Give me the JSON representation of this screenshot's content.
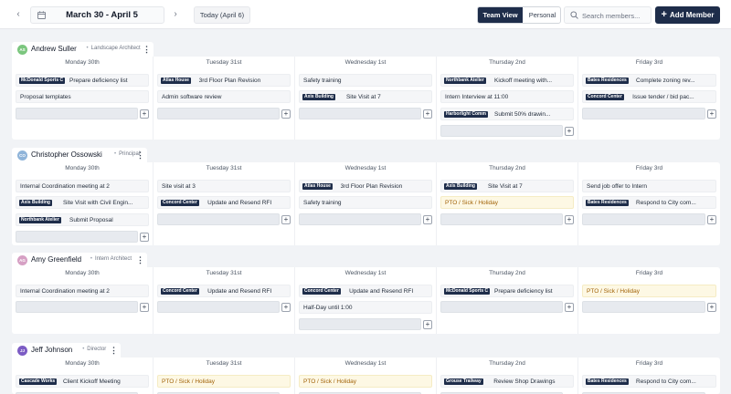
{
  "toolbar": {
    "prev_icon": "chevron-left-icon",
    "next_icon": "chevron-right-icon",
    "calendar_icon": "calendar-icon",
    "date_range": "March 30 - April 5",
    "today_label": "Today (April 6)",
    "view_team": "Team View",
    "view_personal": "Personal",
    "active_view": "Team View",
    "search_placeholder": "Search members...",
    "search_icon": "search-icon",
    "add_member_label": "Add Member",
    "accent_color": "#1e2d4a"
  },
  "days": [
    "Monday 30th",
    "Tuesday 31st",
    "Wednesday 1st",
    "Thursday 2nd",
    "Friday 3rd"
  ],
  "members": [
    {
      "initials": "AS",
      "name": "Andrew Suller",
      "role": "Landscape Architect",
      "avatar_color": "#7bc67e",
      "days": [
        [
          {
            "tag": "McDonald Sports C",
            "text": "Prepare deficiency list"
          },
          {
            "text": "Proposal templates"
          }
        ],
        [
          {
            "tag": "Atlas House",
            "text": "3rd Floor Plan Revision"
          },
          {
            "text": "Admin software review"
          }
        ],
        [
          {
            "text": "Safety training"
          },
          {
            "tag": "Axis Building",
            "text": "Site Visit at 7"
          }
        ],
        [
          {
            "tag": "Northbank Atelier",
            "text": "Kickoff meeting with..."
          },
          {
            "text": "Intern Interview at 11:00"
          },
          {
            "tag": "Harborlight Comm",
            "text": "Submit 50% drawin..."
          }
        ],
        [
          {
            "tag": "Bates Residences",
            "text": "Complete zoning rev..."
          },
          {
            "tag": "Concord Center",
            "text": "Issue tender / bid pac..."
          }
        ]
      ]
    },
    {
      "initials": "CO",
      "name": "Christopher Ossowski",
      "role": "Principal",
      "avatar_color": "#8fb4d9",
      "days": [
        [
          {
            "text": "Internal Coordination meeting at 2"
          },
          {
            "tag": "Axis Building",
            "text": "Site Visit with Civil Engin..."
          },
          {
            "tag": "Northbank Atelier",
            "text": "Submit Proposal"
          }
        ],
        [
          {
            "text": "Site visit at 3"
          },
          {
            "tag": "Concord Center",
            "text": "Update and Resend RFI"
          }
        ],
        [
          {
            "tag": "Atlas House",
            "text": "3rd Floor Plan Revision"
          },
          {
            "text": "Safety training"
          }
        ],
        [
          {
            "tag": "Axis Building",
            "text": "Site Visit at 7"
          },
          {
            "pto": true,
            "text": "PTO / Sick / Holiday"
          }
        ],
        [
          {
            "text": "Send job offer to Intern"
          },
          {
            "tag": "Bates Residences",
            "text": "Respond to City com..."
          }
        ]
      ]
    },
    {
      "initials": "AG",
      "name": "Amy Greenfield",
      "role": "Intern Architect",
      "avatar_color": "#d6a0c4",
      "days": [
        [
          {
            "text": "Internal Coordination meeting at 2"
          }
        ],
        [
          {
            "tag": "Concord Center",
            "text": "Update and Resend RFI"
          }
        ],
        [
          {
            "tag": "Concord Center",
            "text": "Update and Resend RFI"
          },
          {
            "text": "Half-Day until 1:00"
          }
        ],
        [
          {
            "tag": "McDonald Sports C",
            "text": "Prepare deficiency list"
          }
        ],
        [
          {
            "pto": true,
            "text": "PTO / Sick / Holiday"
          }
        ]
      ]
    },
    {
      "initials": "JJ",
      "name": "Jeff Johnson",
      "role": "Director",
      "avatar_color": "#7c5cc4",
      "days": [
        [
          {
            "tag": "Cascade Works",
            "text": "Client Kickoff Meeting"
          }
        ],
        [
          {
            "pto": true,
            "text": "PTO / Sick / Holiday"
          }
        ],
        [
          {
            "pto": true,
            "text": "PTO / Sick / Holiday"
          }
        ],
        [
          {
            "tag": "Grouse Trailway",
            "text": "Review Shop Drawings"
          }
        ],
        [
          {
            "tag": "Bates Residences",
            "text": "Respond to City com..."
          }
        ]
      ]
    }
  ]
}
